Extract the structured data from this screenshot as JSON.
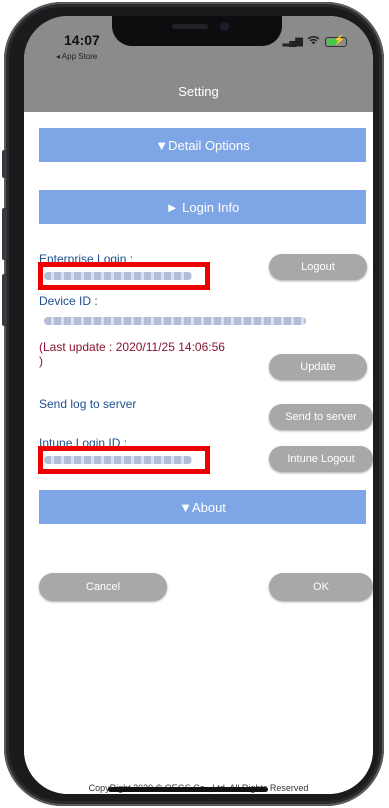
{
  "status_bar": {
    "time": "14:07",
    "back_app": "◂ App Store",
    "signal_icon": "signal-bars-icon",
    "wifi_icon": "wifi-icon",
    "battery_icon": "battery-charging-icon"
  },
  "nav": {
    "title": "Setting"
  },
  "sections": {
    "detail_options": "▼Detail Options",
    "login_info": "► Login Info",
    "about": "▼About"
  },
  "login_info": {
    "enterprise_login_label": "Enterprise Login :",
    "logout_button": "Logout",
    "device_id_label": "Device ID :",
    "last_update": "(Last update : 2020/11/25 14:06:56 )",
    "update_button": "Update",
    "send_log_label": "Send log to server",
    "send_to_server_button": "Send to server",
    "intune_login_label": "Intune Login ID :",
    "intune_logout_button": "Intune Logout"
  },
  "actions": {
    "cancel": "Cancel",
    "ok": "OK"
  },
  "footer": {
    "copyright": "CopyRight 2020 © OEGS Co., Ltd. All Rights Reserved"
  },
  "colors": {
    "section_bar": "#7ea6e6",
    "nav_bar": "#8b8b8b",
    "button": "#a8a8a8",
    "label_blue": "#1d4f8c",
    "label_red": "#8a1433",
    "highlight_box": "#f00000"
  }
}
